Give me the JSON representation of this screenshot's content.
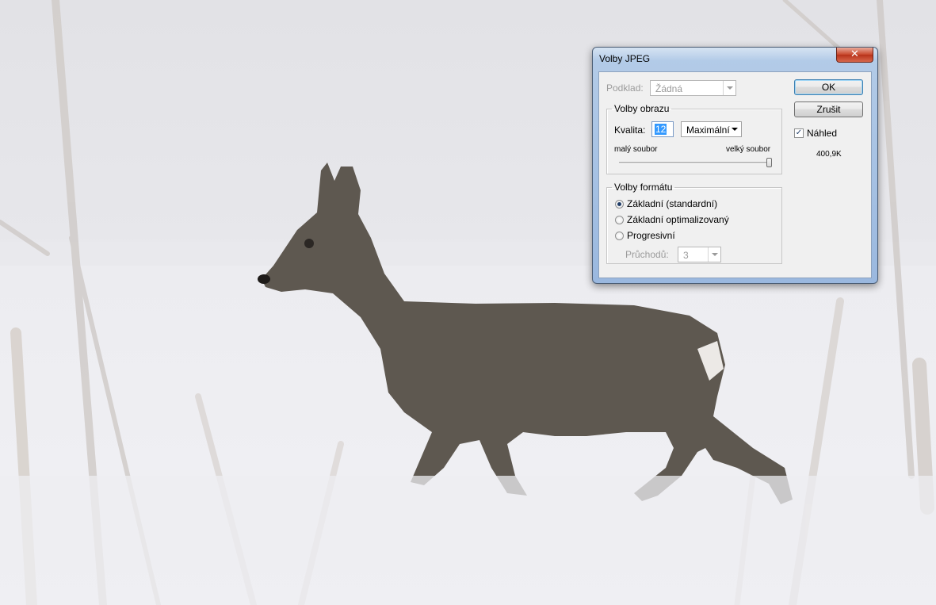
{
  "dialog": {
    "title": "Volby JPEG",
    "close_glyph": "✕",
    "matte": {
      "label": "Podklad:",
      "value": "Žádná",
      "enabled": false
    },
    "image_options": {
      "legend": "Volby obrazu",
      "quality_label": "Kvalita:",
      "quality_value": "12",
      "quality_preset": "Maximální",
      "slider_min_label": "malý soubor",
      "slider_max_label": "velký soubor",
      "slider_level": 1.0
    },
    "format_options": {
      "legend": "Volby formátu",
      "options": [
        {
          "label": "Základní (standardní)",
          "selected": true
        },
        {
          "label": "Základní optimalizovaný",
          "selected": false
        },
        {
          "label": "Progresivní",
          "selected": false
        }
      ],
      "scans_label": "Průchodů:",
      "scans_value": "3",
      "scans_enabled": false
    },
    "ok_label": "OK",
    "cancel_label": "Zrušit",
    "preview_label": "Náhled",
    "preview_checked": true,
    "file_size": "400,9K"
  },
  "background": {
    "subject": "roe-deer-in-snow-photo",
    "colors": {
      "sky": "#e4e4e8",
      "snow": "#f0f0f4",
      "deer": "#5e5850"
    }
  }
}
